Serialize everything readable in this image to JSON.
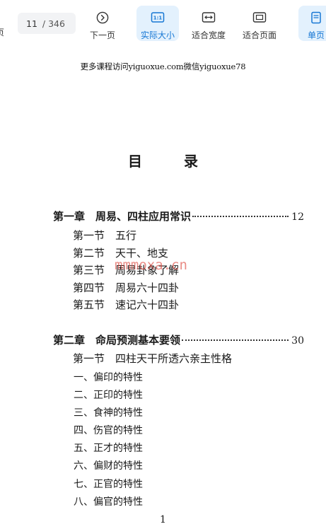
{
  "toolbar": {
    "prev_label": "页",
    "page_current": "11",
    "page_total": "/ 346",
    "next_label": "下一页",
    "actual_size_label": "实际大小",
    "fit_width_label": "适合宽度",
    "fit_page_label": "适合页面",
    "single_page_label": "单页",
    "accent_color": "#1677d4",
    "active_bg": "#e3f1fd",
    "icons": [
      "chevron-right-circle-icon",
      "actual-size-icon",
      "fit-width-icon",
      "fit-page-icon",
      "single-page-icon"
    ]
  },
  "document": {
    "header_watermark": "更多课程访问yiguoxue.com微信yiguoxue78",
    "toc_title": "目 录",
    "overlay_watermark": "mmmoxa.cn",
    "page_number": "1",
    "chapters": [
      {
        "title": "第一章　周易、四柱应用常识",
        "page": "12",
        "sections": [
          "第一节　五行",
          "第二节　天干、地支",
          "第三节　周易卦象了解",
          "第四节　周易六十四卦",
          "第五节　速记六十四卦"
        ]
      },
      {
        "title": "第二章　命局预测基本要领",
        "page": "30",
        "sections": [
          "第一节　四柱天干所透六亲主性格"
        ],
        "subsections": [
          "一、偏印的特性",
          "二、正印的特性",
          "三、食神的特性",
          "四、伤官的特性",
          "五、正才的特性",
          "六、偏财的特性",
          "七、正官的特性",
          "八、偏官的特性"
        ]
      }
    ]
  }
}
